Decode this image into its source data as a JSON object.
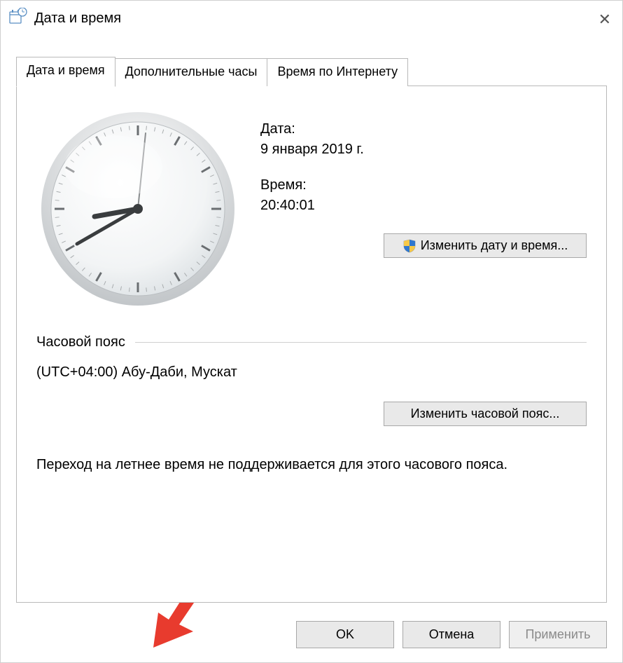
{
  "window": {
    "title": "Дата и время"
  },
  "tabs": [
    {
      "label": "Дата и время"
    },
    {
      "label": "Дополнительные часы"
    },
    {
      "label": "Время по Интернету"
    }
  ],
  "date_section": {
    "date_label": "Дата:",
    "date_value": "9 января 2019 г.",
    "time_label": "Время:",
    "time_value": "20:40:01",
    "change_btn": "Изменить дату и время..."
  },
  "tz_section": {
    "header": "Часовой пояс",
    "value": "(UTC+04:00) Абу-Даби, Мускат",
    "change_btn": "Изменить часовой пояс..."
  },
  "dst_note": "Переход на летнее время не поддерживается для этого часового пояса.",
  "buttons": {
    "ok": "OK",
    "cancel": "Отмена",
    "apply": "Применить"
  },
  "clock": {
    "hour": 20,
    "minute": 40,
    "second": 1
  }
}
